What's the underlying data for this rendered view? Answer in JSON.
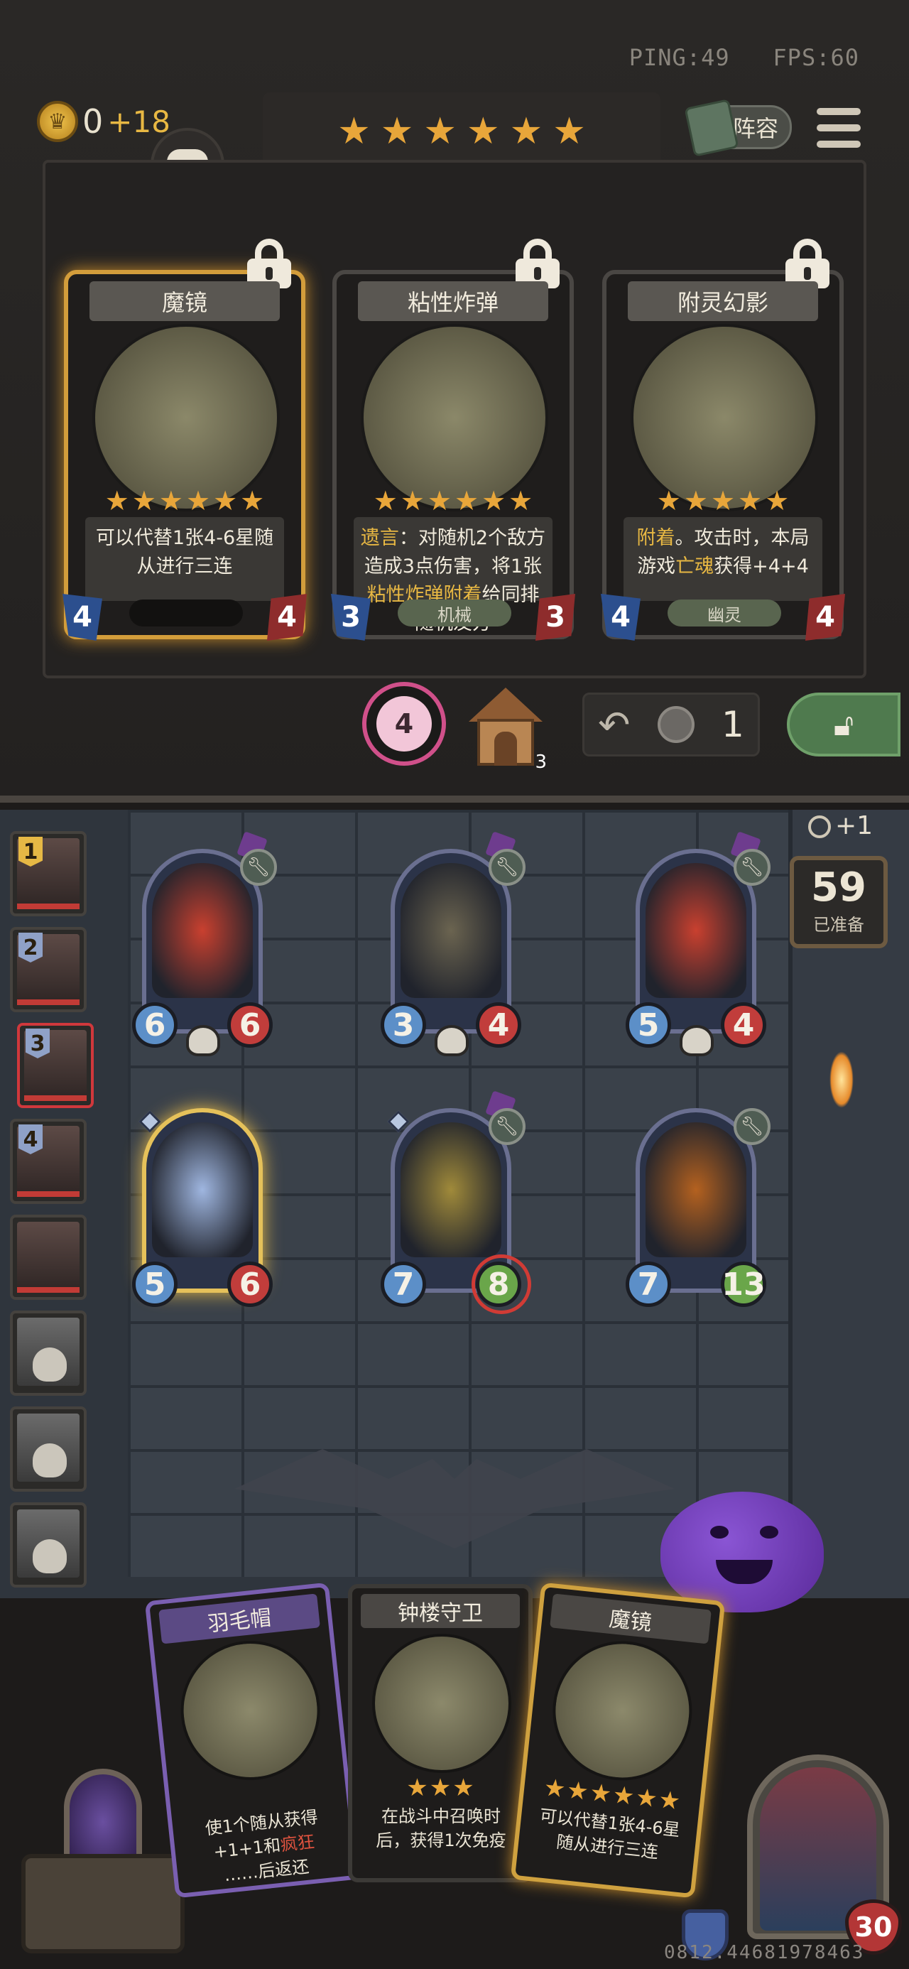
{
  "status": {
    "ping": "PING:49",
    "fps": "FPS:60"
  },
  "gold": {
    "value": "0",
    "gain": "+18"
  },
  "tier_stars": [
    "★",
    "★",
    "★",
    "★",
    "★",
    "★"
  ],
  "lineup_label": "阵容",
  "shop_cards": [
    {
      "name": "魔镜",
      "stars": [
        "★",
        "★",
        "★",
        "★",
        "★",
        "★"
      ],
      "desc_parts": [
        {
          "t": "可以代替1张4-6星随从进行三连",
          "kw": false
        }
      ],
      "tag": "",
      "attack": "4",
      "health": "4"
    },
    {
      "name": "粘性炸弹",
      "stars": [
        "★",
        "★",
        "★",
        "★",
        "★",
        "★"
      ],
      "desc_parts": [
        {
          "t": "遗言",
          "kw": true
        },
        {
          "t": "：对随机2个敌方造成3点伤害，将1张",
          "kw": false
        },
        {
          "t": "粘性炸弹",
          "kw": true
        },
        {
          "t": "附着",
          "kw": true
        },
        {
          "t": "给同排随机友方",
          "kw": false
        }
      ],
      "tag": "机械",
      "attack": "3",
      "health": "3"
    },
    {
      "name": "附灵幻影",
      "stars": [
        "★",
        "★",
        "★",
        "★",
        "★"
      ],
      "desc_parts": [
        {
          "t": "附着",
          "kw": true
        },
        {
          "t": "。攻击时，本局游戏",
          "kw": false
        },
        {
          "t": "亡魂",
          "kw": true
        },
        {
          "t": "获得+4+4",
          "kw": false
        }
      ],
      "tag": "幽灵",
      "attack": "4",
      "health": "4"
    }
  ],
  "actions": {
    "coin_timer": "4",
    "house_count": "3",
    "refresh_cost": "1"
  },
  "board_info": {
    "plus": "+1",
    "ready_count": "59",
    "ready_label": "已准备"
  },
  "players": [
    {
      "rank": "1",
      "dead": false
    },
    {
      "rank": "2",
      "dead": false
    },
    {
      "rank": "3",
      "dead": false,
      "active": true
    },
    {
      "rank": "4",
      "dead": false
    },
    {
      "rank": "",
      "dead": false
    },
    {
      "rank": "",
      "dead": true
    },
    {
      "rank": "",
      "dead": true
    },
    {
      "rank": "",
      "dead": true
    }
  ],
  "minions": [
    {
      "name": "red-dragon-minion",
      "attack": "6",
      "health": "6",
      "golden": false,
      "color": "#c9402f"
    },
    {
      "name": "hooded-scavenger-minion",
      "attack": "3",
      "health": "4",
      "golden": false,
      "color": "#6b6450"
    },
    {
      "name": "red-dragon-minion-2",
      "attack": "5",
      "health": "4",
      "golden": false,
      "color": "#c9402f"
    },
    {
      "name": "mermaid-minion",
      "attack": "5",
      "health": "6",
      "golden": true,
      "color": "#9fb6e0"
    },
    {
      "name": "clocktower-guard-minion",
      "attack": "7",
      "health": "8",
      "golden": false,
      "color": "#a08a3a"
    },
    {
      "name": "hooded-cultist-minion",
      "attack": "7",
      "health": "13",
      "golden": false,
      "color": "#b4611f"
    }
  ],
  "hand": [
    {
      "name": "羽毛帽",
      "stars": [],
      "desc_lines": [
        [
          {
            "t": "使1个随从获得",
            "c": ""
          }
        ],
        [
          {
            "t": "+1+1和",
            "c": ""
          },
          {
            "t": "疯狂",
            "c": "red"
          }
        ],
        [
          {
            "t": "……后返还",
            "c": ""
          }
        ]
      ]
    },
    {
      "name": "钟楼守卫",
      "stars": [
        "★",
        "★",
        "★"
      ],
      "desc_lines": [
        [
          {
            "t": "在战斗中召唤时",
            "c": ""
          }
        ],
        [
          {
            "t": "后，获得1次免疫",
            "c": ""
          }
        ]
      ]
    },
    {
      "name": "魔镜",
      "stars": [
        "★",
        "★",
        "★",
        "★",
        "★",
        "★"
      ],
      "desc_lines": [
        [
          {
            "t": "可以代替1张4-6星",
            "c": ""
          }
        ],
        [
          {
            "t": "随从进行三连",
            "c": ""
          }
        ]
      ]
    }
  ],
  "hero": {
    "health": "30"
  },
  "uid": "0812.44681978463"
}
